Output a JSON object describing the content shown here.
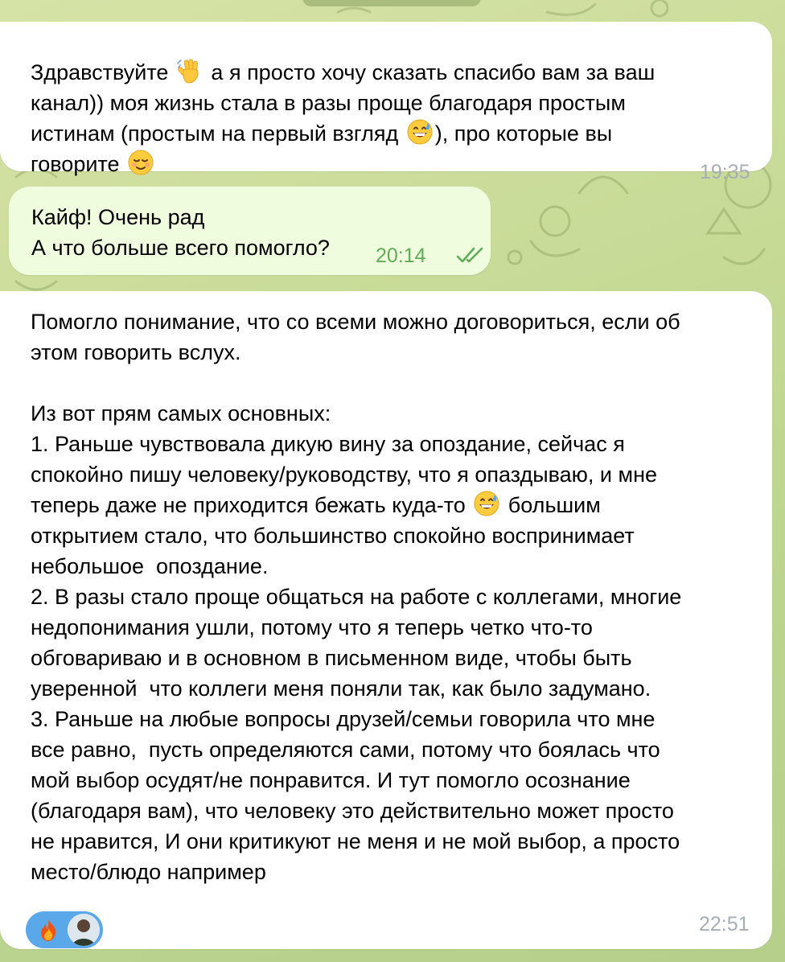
{
  "messages": [
    {
      "id": "msg-1",
      "direction": "incoming",
      "lines": [
        {
          "parts": [
            "Здравствуйте ",
            {
              "emoji": "waving-hand"
            },
            " а я просто хочу сказать спасибо вам за ваш"
          ]
        },
        {
          "parts": [
            "канал)) моя жизнь стала в разы проще благодаря простым"
          ]
        },
        {
          "parts": [
            "истинам (простым на первый взгляд ",
            {
              "emoji": "grinning-sweat"
            },
            "), про которые вы"
          ]
        },
        {
          "parts": [
            "говорите ",
            {
              "emoji": "relieved-face"
            }
          ]
        }
      ],
      "time": "19:35"
    },
    {
      "id": "msg-2",
      "direction": "outgoing",
      "lines": [
        {
          "parts": [
            "Кайф! Очень рад"
          ]
        },
        {
          "parts": [
            "А что больше всего помогло?"
          ]
        }
      ],
      "time": "20:14",
      "status": "read-double-check"
    },
    {
      "id": "msg-3",
      "direction": "incoming",
      "lines": [
        {
          "parts": [
            "Помогло понимание, что со всеми можно договориться, если об"
          ]
        },
        {
          "parts": [
            "этом говорить вслух."
          ]
        },
        {
          "parts": [
            ""
          ]
        },
        {
          "parts": [
            "Из вот прям самых основных:"
          ]
        },
        {
          "parts": [
            "1. Раньше чувствовала дикую вину за опоздание, сейчас я"
          ]
        },
        {
          "parts": [
            "спокойно пишу человеку/руководству, что я опаздываю, и мне"
          ]
        },
        {
          "parts": [
            "теперь даже не приходится бежать куда-то ",
            {
              "emoji": "grinning-sweat"
            },
            " большим"
          ]
        },
        {
          "parts": [
            "открытием стало, что большинство спокойно воспринимает"
          ]
        },
        {
          "parts": [
            "небольшое  опоздание."
          ]
        },
        {
          "parts": [
            "2. В разы стало проще общаться на работе с коллегами, многие"
          ]
        },
        {
          "parts": [
            "недопонимания ушли, потому что я теперь четко что-то"
          ]
        },
        {
          "parts": [
            "обговариваю и в основном в письменном виде, чтобы быть"
          ]
        },
        {
          "parts": [
            "уверенной  что коллеги меня поняли так, как было задумано."
          ]
        },
        {
          "parts": [
            "3. Раньше на любые вопросы друзей/семьи говорила что мне"
          ]
        },
        {
          "parts": [
            "все равно,  пусть определяются сами, потому что боялась что"
          ]
        },
        {
          "parts": [
            "мой выбор осудят/не понравится. И тут помогло осознание"
          ]
        },
        {
          "parts": [
            "(благодаря вам), что человеку это действительно может просто"
          ]
        },
        {
          "parts": [
            "не нравится, И они критикуют не меня и не мой выбор, а просто"
          ]
        },
        {
          "parts": [
            "место/блюдо например"
          ]
        }
      ],
      "time": "22:51",
      "reaction": {
        "emoji": "fire",
        "avatar": "user-avatar"
      }
    }
  ],
  "colors": {
    "incoming_bubble": "#ffffff",
    "outgoing_bubble": "#effdde",
    "incoming_time": "#a6aeb6",
    "outgoing_time": "#5fae56",
    "reaction_badge": "#5aa7ea",
    "wallpaper": "#c9db98"
  }
}
